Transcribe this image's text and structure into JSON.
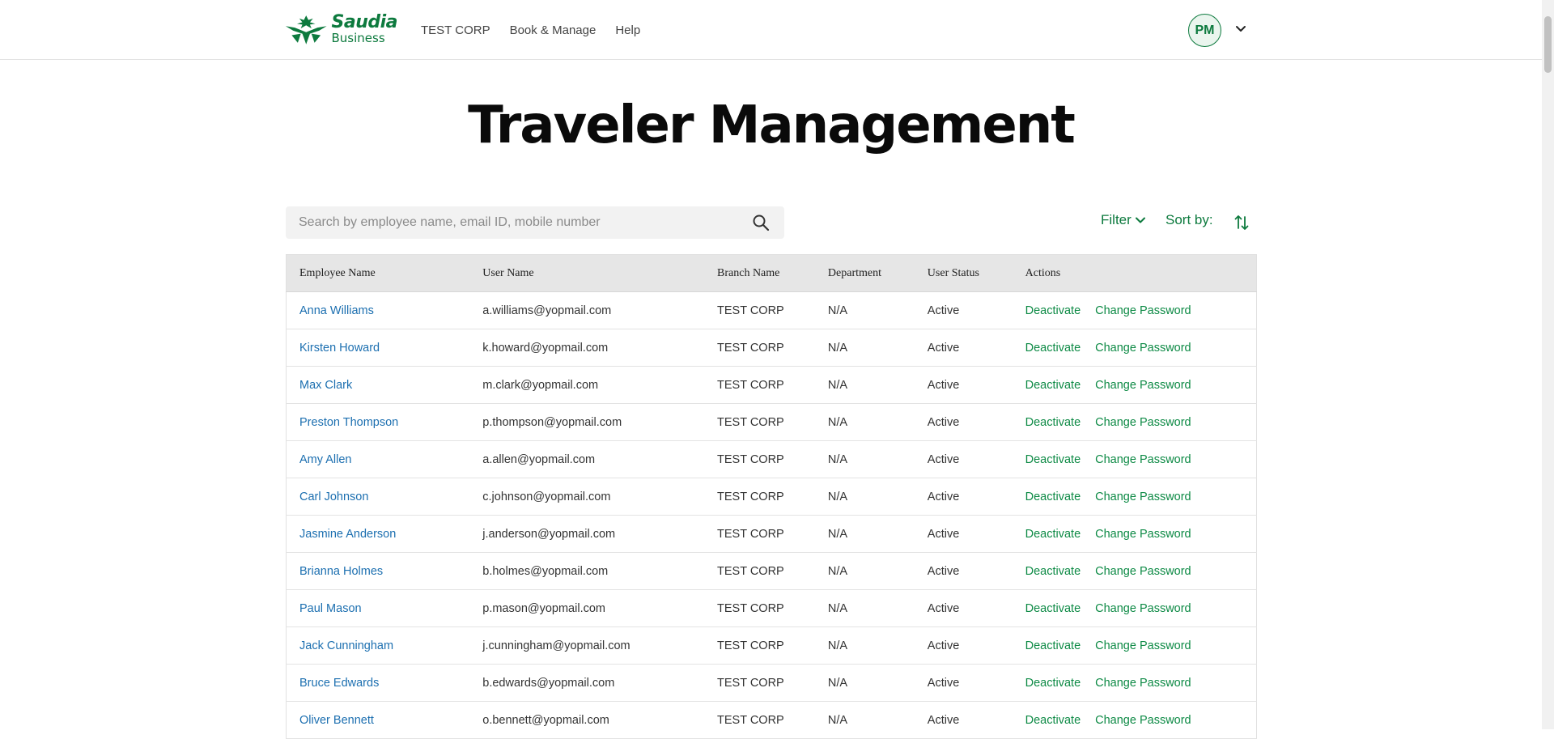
{
  "brand": {
    "name_line1": "Saudia",
    "name_line2": "Business",
    "color": "#0d7a3e"
  },
  "nav": {
    "items": [
      {
        "label": "TEST CORP"
      },
      {
        "label": "Book & Manage"
      },
      {
        "label": "Help"
      }
    ]
  },
  "user": {
    "initials": "PM"
  },
  "page": {
    "title": "Traveler Management"
  },
  "toolbar": {
    "search_placeholder": "Search by employee name, email ID, mobile number",
    "search_value": "",
    "filter_label": "Filter",
    "sort_label": "Sort by:"
  },
  "table": {
    "headers": [
      "Employee Name",
      "User Name",
      "Branch Name",
      "Department",
      "User Status",
      "Actions"
    ],
    "rows": [
      {
        "name": "Anna Williams",
        "user": "a.williams@yopmail.com",
        "branch": "TEST CORP",
        "dept": "N/A",
        "status": "Active",
        "action1": "Deactivate",
        "action2": "Change Password"
      },
      {
        "name": "Kirsten Howard",
        "user": "k.howard@yopmail.com",
        "branch": "TEST CORP",
        "dept": "N/A",
        "status": "Active",
        "action1": "Deactivate",
        "action2": "Change Password"
      },
      {
        "name": "Max Clark",
        "user": "m.clark@yopmail.com",
        "branch": "TEST CORP",
        "dept": "N/A",
        "status": "Active",
        "action1": "Deactivate",
        "action2": "Change Password"
      },
      {
        "name": "Preston Thompson",
        "user": "p.thompson@yopmail.com",
        "branch": "TEST CORP",
        "dept": "N/A",
        "status": "Active",
        "action1": "Deactivate",
        "action2": "Change Password"
      },
      {
        "name": "Amy Allen",
        "user": "a.allen@yopmail.com",
        "branch": "TEST CORP",
        "dept": "N/A",
        "status": "Active",
        "action1": "Deactivate",
        "action2": "Change Password"
      },
      {
        "name": "Carl Johnson",
        "user": "c.johnson@yopmail.com",
        "branch": "TEST CORP",
        "dept": "N/A",
        "status": "Active",
        "action1": "Deactivate",
        "action2": "Change Password"
      },
      {
        "name": "Jasmine Anderson",
        "user": "j.anderson@yopmail.com",
        "branch": "TEST CORP",
        "dept": "N/A",
        "status": "Active",
        "action1": "Deactivate",
        "action2": "Change Password"
      },
      {
        "name": "Brianna Holmes",
        "user": "b.holmes@yopmail.com",
        "branch": "TEST CORP",
        "dept": "N/A",
        "status": "Active",
        "action1": "Deactivate",
        "action2": "Change Password"
      },
      {
        "name": "Paul Mason",
        "user": "p.mason@yopmail.com",
        "branch": "TEST CORP",
        "dept": "N/A",
        "status": "Active",
        "action1": "Deactivate",
        "action2": "Change Password"
      },
      {
        "name": "Jack Cunningham",
        "user": "j.cunningham@yopmail.com",
        "branch": "TEST CORP",
        "dept": "N/A",
        "status": "Active",
        "action1": "Deactivate",
        "action2": "Change Password"
      },
      {
        "name": "Bruce Edwards",
        "user": "b.edwards@yopmail.com",
        "branch": "TEST CORP",
        "dept": "N/A",
        "status": "Active",
        "action1": "Deactivate",
        "action2": "Change Password"
      },
      {
        "name": "Oliver Bennett",
        "user": "o.bennett@yopmail.com",
        "branch": "TEST CORP",
        "dept": "N/A",
        "status": "Active",
        "action1": "Deactivate",
        "action2": "Change Password"
      }
    ]
  },
  "icons": {
    "logo": "palm-swords-logo-icon",
    "search": "search-icon",
    "filter_chevron": "chevron-down-icon",
    "sort": "sort-arrows-icon",
    "account_chevron": "chevron-down-icon"
  },
  "colors": {
    "accent": "#0d7a3e",
    "link": "#1c6fb0",
    "action": "#0d8a45",
    "header_row": "#e6e6e6"
  }
}
